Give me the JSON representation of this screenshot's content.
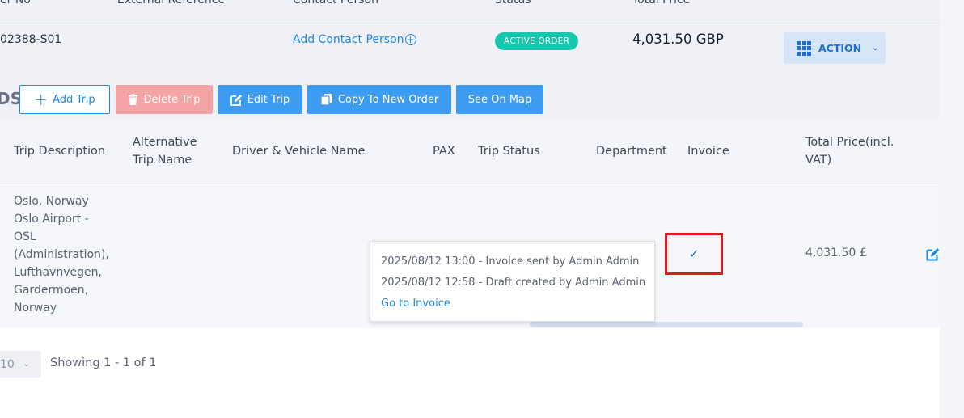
{
  "order_header": {
    "columns": [
      "er No",
      "External Reference",
      "Contact Person",
      "Status",
      "Total Price"
    ],
    "order_no": "02388-S01",
    "contact_link": "Add Contact Person",
    "status": "ACTIVE ORDER",
    "total_price": "4,031.50 GBP",
    "action_label": "ACTION"
  },
  "toolbar": {
    "section_title": "DS",
    "add_trip": "Add Trip",
    "delete_trip": "Delete Trip",
    "edit_trip": "Edit Trip",
    "copy_to_new_order": "Copy To New Order",
    "see_on_map": "See On Map"
  },
  "table": {
    "headers": {
      "trip_description": "Trip Description",
      "alternative_trip_name_1": "Alternative",
      "alternative_trip_name_2": "Trip Name",
      "driver_vehicle": "Driver & Vehicle Name",
      "pax": "PAX",
      "trip_status": "Trip Status",
      "department": "Department",
      "invoice": "Invoice",
      "total_price_1": "Total Price(incl.",
      "total_price_2": "VAT)"
    },
    "rows": [
      {
        "description_lines": [
          "Oslo, Norway",
          "Oslo Airport -",
          "OSL",
          "(Administration),",
          "Lufthavnvegen,",
          "Gardermoen,",
          "Norway"
        ],
        "total_price": "4,031.50 £"
      }
    ]
  },
  "tooltip": {
    "line1": "2025/08/12 13:00 - Invoice sent by Admin Admin",
    "line2": "2025/08/12 12:58 - Draft created by Admin Admin",
    "link": "Go to Invoice"
  },
  "pagination": {
    "page_size": "10",
    "showing": "Showing 1 - 1 of 1"
  },
  "colors": {
    "accent": "#1e88e5",
    "status_active": "#14c7ad",
    "delete_disabled": "#f4a4a4",
    "highlight_box": "#e0191f"
  }
}
